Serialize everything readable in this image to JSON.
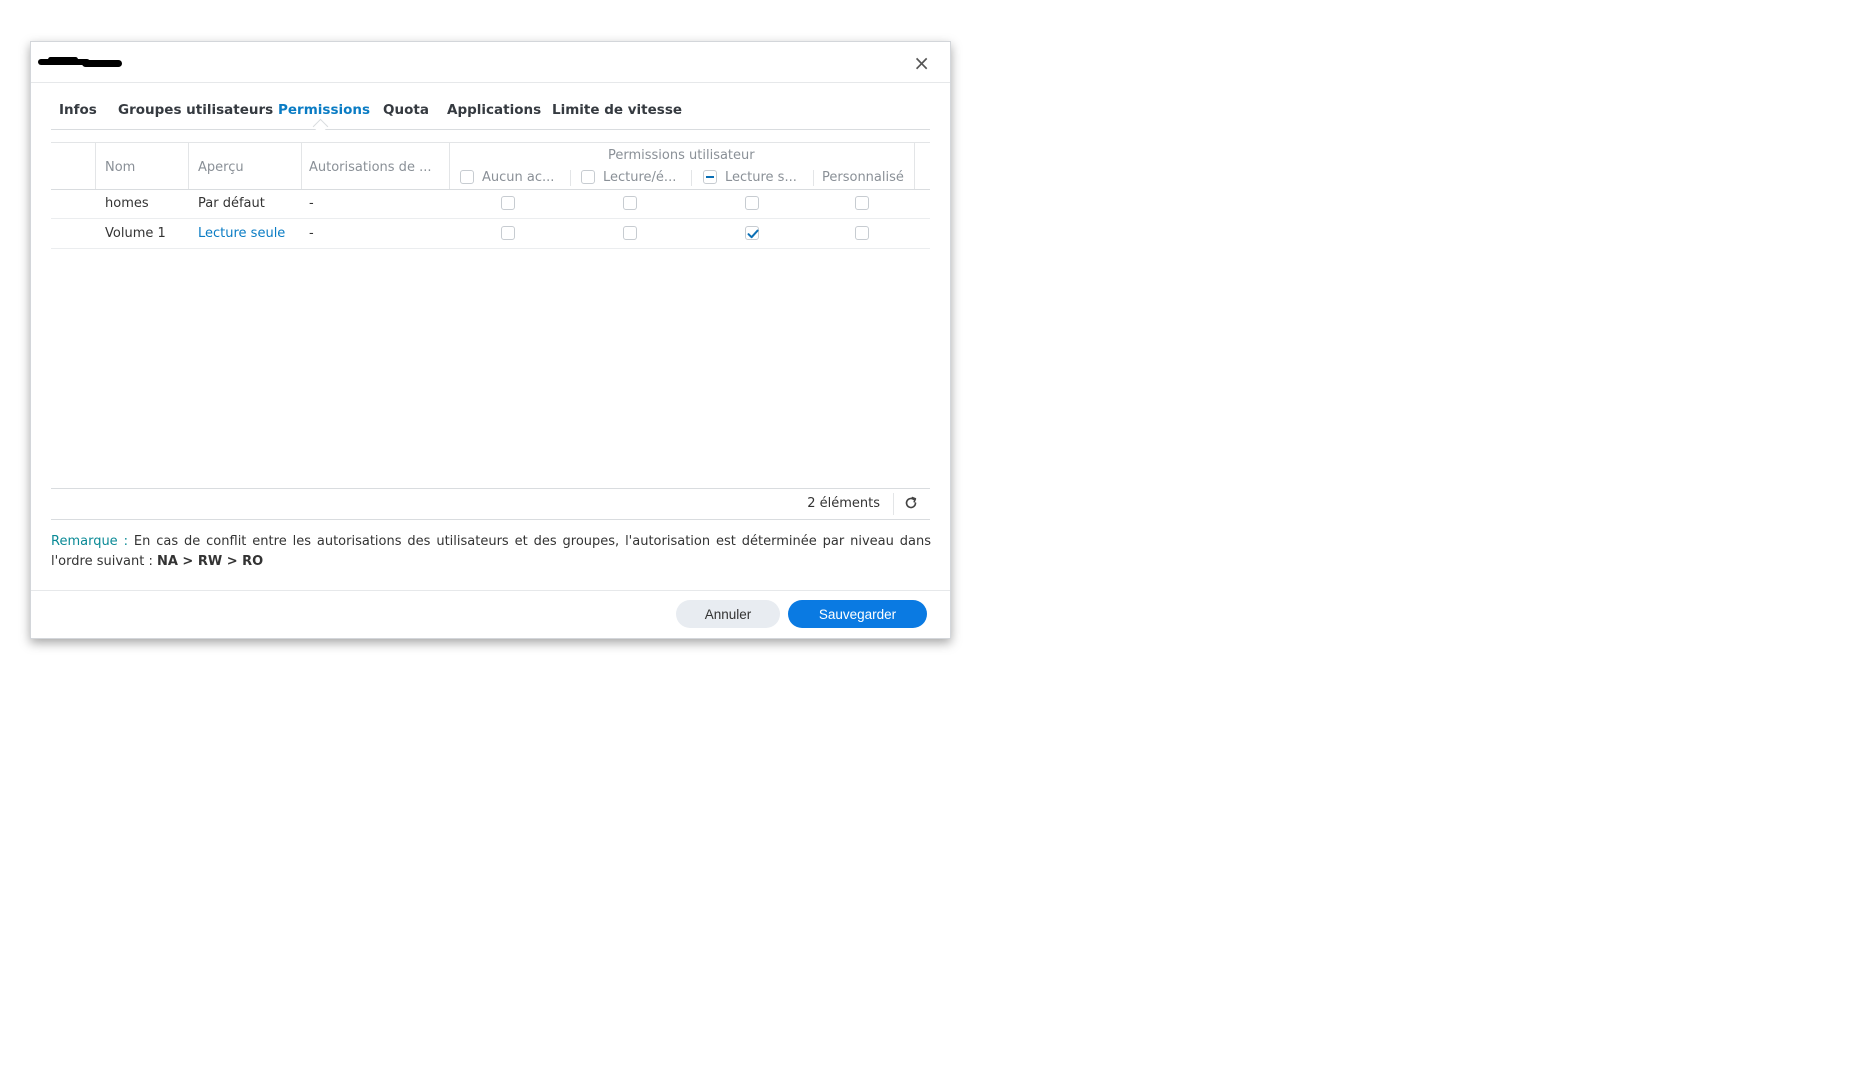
{
  "dialog": {
    "close_label": "×"
  },
  "tabs": [
    {
      "label": "Infos"
    },
    {
      "label": "Groupes utilisateurs"
    },
    {
      "label": "Permissions"
    },
    {
      "label": "Quota"
    },
    {
      "label": "Applications"
    },
    {
      "label": "Limite de vitesse"
    }
  ],
  "active_tab": "Permissions",
  "grid": {
    "headers": {
      "nom": "Nom",
      "apercu": "Aperçu",
      "autorisations": "Autorisations de ...",
      "group": "Permissions utilisateur",
      "aucun": "Aucun ac...",
      "lecture_ecriture": "Lecture/é...",
      "lecture_seule": "Lecture s...",
      "personnalise": "Personnalisé"
    },
    "header_checkbox_states": {
      "aucun": "unchecked",
      "lecture_ecriture": "unchecked",
      "lecture_seule": "partial"
    },
    "rows": [
      {
        "nom": "homes",
        "apercu": "Par défaut",
        "autorisations": "-",
        "checks": [
          false,
          false,
          false,
          false
        ]
      },
      {
        "nom": "Volume 1",
        "apercu": "Lecture seule",
        "autorisations": "-",
        "checks": [
          false,
          false,
          true,
          false
        ]
      }
    ],
    "count_text": "2 éléments"
  },
  "note": {
    "label": "Remarque :",
    "text": " En cas de conflit entre les autorisations des utilisateurs et des groupes, l'autorisation est déterminée par niveau dans l'ordre suivant : ",
    "order": "NA > RW > RO"
  },
  "buttons": {
    "cancel": "Annuler",
    "save": "Sauvegarder"
  },
  "colors": {
    "accent": "#0a7cc4",
    "save_button": "#0a7ae2",
    "note_label": "#0a8a96"
  }
}
